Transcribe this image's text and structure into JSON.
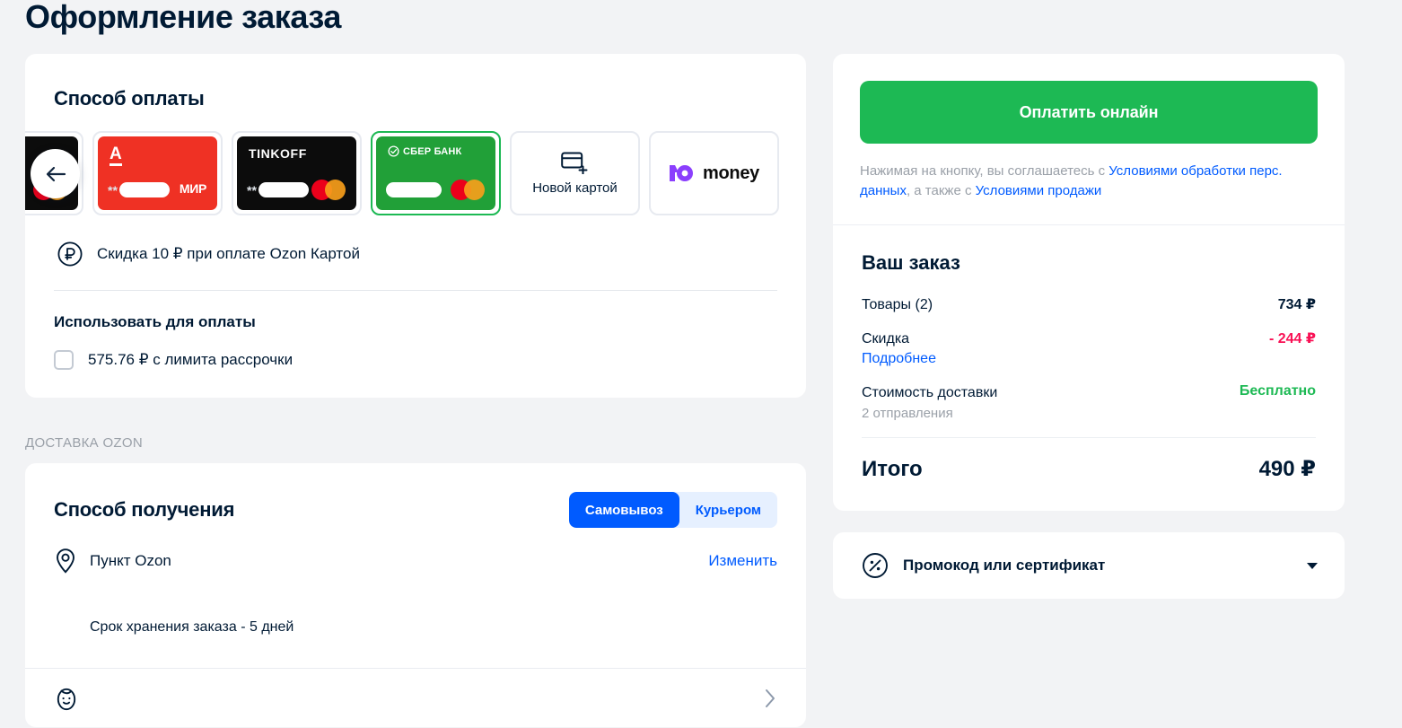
{
  "page": {
    "title": "Оформление заказа",
    "background_color": "#f2f3f5",
    "text_color": "#001a34"
  },
  "payment": {
    "heading": "Способ оплаты",
    "scroll_left_icon": "arrow-left-icon",
    "cards": [
      {
        "id": "card-partial-black",
        "brand": "",
        "masked": "",
        "network": "mastercard",
        "style": "black",
        "selected": false,
        "partial": true
      },
      {
        "id": "card-alfa",
        "brand": "A",
        "masked": "**",
        "network": "mir",
        "network_label": "МИР",
        "style": "red",
        "selected": false
      },
      {
        "id": "card-tinkoff",
        "brand": "TINKOFF",
        "masked": "**",
        "network": "mastercard",
        "style": "black",
        "selected": false
      },
      {
        "id": "card-sberbank",
        "brand": "СБЕР БАНК",
        "masked": "",
        "network": "mastercard",
        "style": "green",
        "selected": true
      }
    ],
    "new_card": {
      "label": "Новой картой",
      "icon": "credit-card-plus-icon"
    },
    "yoomoney": {
      "mark": "Ю",
      "label": "money"
    },
    "discount_note": {
      "icon": "ruble-circle-icon",
      "text": "Скидка 10 ₽ при оплате Ozon Картой"
    },
    "use_for_payment": {
      "heading": "Использовать для оплаты",
      "option_label": "575.76 ₽ с лимита рассрочки",
      "checked": false
    }
  },
  "delivery": {
    "section_label": "ДОСТАВКА OZON",
    "heading": "Способ получения",
    "segments": [
      {
        "label": "Самовывоз",
        "active": true
      },
      {
        "label": "Курьером",
        "active": false
      }
    ],
    "pickup": {
      "icon": "location-pin-icon",
      "name": "Пункт Ozon",
      "change_label": "Изменить"
    },
    "storage_note": "Срок хранения заказа - 5  дней",
    "recipient": {
      "icon": "person-face-icon",
      "name": "",
      "chevron_icon": "chevron-right-icon"
    }
  },
  "summary": {
    "pay_button": "Оплатить онлайн",
    "pay_button_color": "#1db954",
    "terms": {
      "prefix": "Нажимая на кнопку, вы соглашаетесь с ",
      "link1": "Условиями обработки перс. данных",
      "middle": ", а также с ",
      "link2": "Условиями продажи"
    },
    "order_title": "Ваш заказ",
    "rows": [
      {
        "label": "Товары (2)",
        "sub": "",
        "sublink": "",
        "value": "734 ₽",
        "value_style": "default"
      },
      {
        "label": "Скидка",
        "sub": "",
        "sublink": "Подробнее",
        "value": "- 244 ₽",
        "value_style": "negative"
      },
      {
        "label": "Стоимость доставки",
        "sub": "2 отправления",
        "sublink": "",
        "value": "Бесплатно",
        "value_style": "free"
      }
    ],
    "total_label": "Итого",
    "total_value": "490 ₽",
    "colors": {
      "negative": "#f91155",
      "free": "#1db954",
      "link": "#005bff"
    }
  },
  "promo": {
    "icon": "percent-circle-icon",
    "label": "Промокод или сертификат",
    "caret_icon": "chevron-down-icon",
    "expanded": false
  }
}
